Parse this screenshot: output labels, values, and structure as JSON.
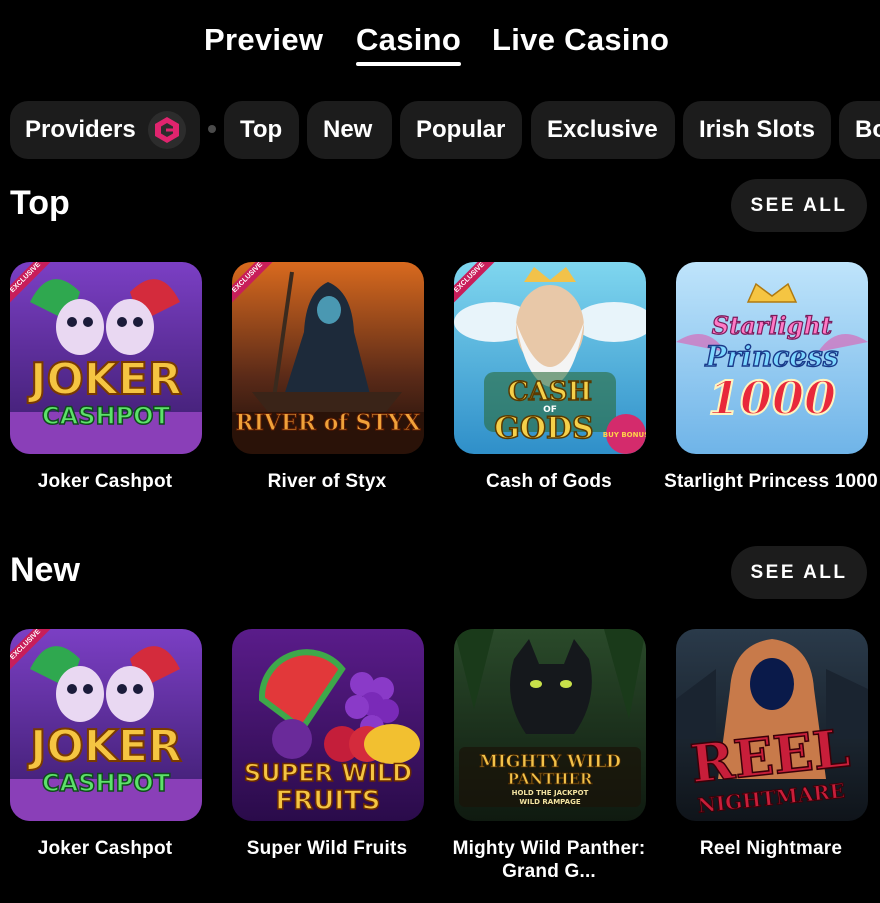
{
  "tabs": [
    {
      "label": "Preview",
      "active": false
    },
    {
      "label": "Casino",
      "active": true
    },
    {
      "label": "Live Casino",
      "active": false
    }
  ],
  "chips": {
    "providers": "Providers",
    "providers_icon": "providers-logo-icon",
    "items": [
      "Top",
      "New",
      "Popular",
      "Exclusive",
      "Irish Slots",
      "Bo"
    ]
  },
  "sections": [
    {
      "title": "Top",
      "see_all": "SEE ALL",
      "games": [
        {
          "name": "Joker Cashpot",
          "logo": "JOKER",
          "logo2": "CASHPOT",
          "badge": "EXCLUSIVE"
        },
        {
          "name": "River of Styx",
          "logo": "RIVER of STYX",
          "badge": "EXCLUSIVE"
        },
        {
          "name": "Cash of Gods",
          "logo": "CASH",
          "logo_mid": "OF",
          "logo2": "GODS",
          "badge": "EXCLUSIVE",
          "corner": "BUY BONUS"
        },
        {
          "name": "Starlight Princess 1000",
          "logo": "Starlight",
          "logo2": "Princess",
          "logo3": "1000"
        }
      ]
    },
    {
      "title": "New",
      "see_all": "SEE ALL",
      "games": [
        {
          "name": "Joker Cashpot",
          "logo": "JOKER",
          "logo2": "CASHPOT",
          "badge": "EXCLUSIVE"
        },
        {
          "name": "Super Wild Fruits",
          "logo": "SUPER WILD",
          "logo2": "FRUITS"
        },
        {
          "name": "Mighty Wild Panther: Grand G...",
          "logo": "MIGHTY WILD",
          "logo2": "PANTHER",
          "logo3": "HOLD THE JACKPOT",
          "logo4": "WILD RAMPAGE"
        },
        {
          "name": "Reel Nightmare",
          "logo": "REEL",
          "logo2": "NIGHTMARE"
        }
      ]
    }
  ],
  "colors": {
    "background": "#000000",
    "chip_bg": "#1c1c1c",
    "accent_pink": "#e0246e",
    "text": "#ffffff"
  }
}
